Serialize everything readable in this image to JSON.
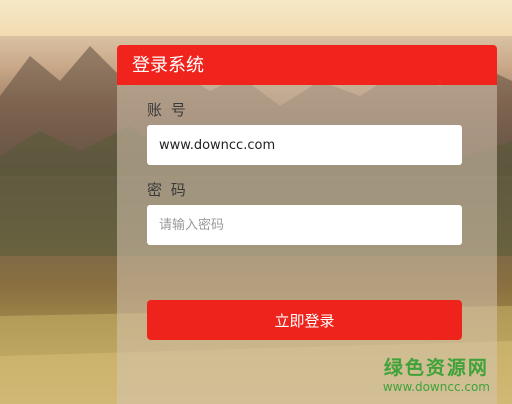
{
  "login_panel": {
    "title": "登录系统",
    "account_label": "账 号",
    "account_value": "www.downcc.com",
    "password_label": "密 码",
    "password_placeholder": "请输入密码",
    "submit_label": "立即登录"
  },
  "watermark": {
    "name": "绿色资源网",
    "url": "www.downcc.com"
  },
  "colors": {
    "accent": "#f0241c",
    "watermark": "#3fa33a"
  }
}
